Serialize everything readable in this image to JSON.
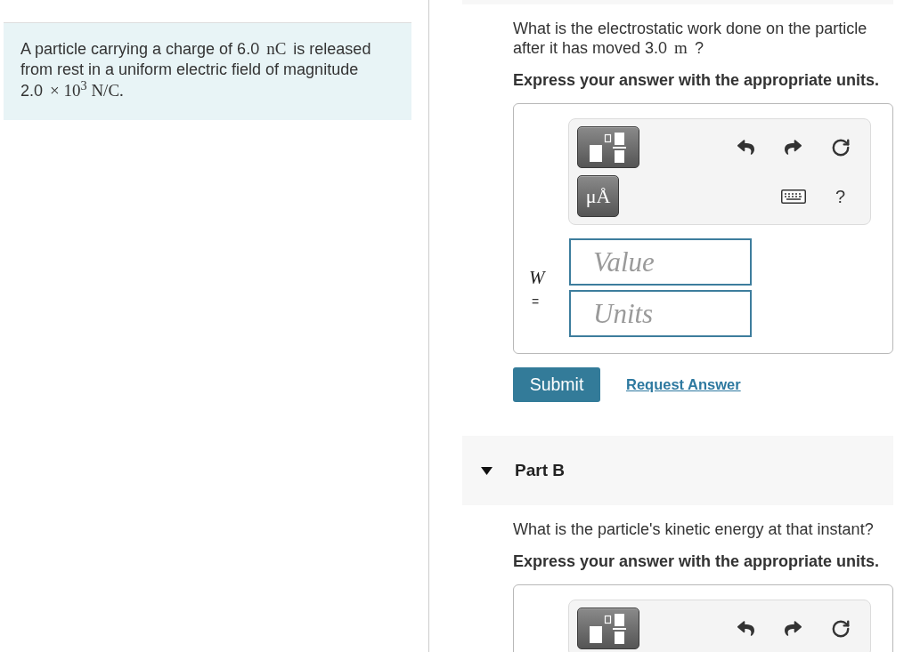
{
  "problem": {
    "segments": [
      {
        "kind": "text",
        "text": "A particle carrying a charge of 6.0 "
      },
      {
        "kind": "math",
        "text": "nC"
      },
      {
        "kind": "text",
        "text": " is released from rest in a uniform electric field of magnitude 2.0 "
      },
      {
        "kind": "math",
        "text": "× 10$^{3}$ N/C."
      }
    ]
  },
  "parts": [
    {
      "question": {
        "segments": [
          {
            "kind": "text",
            "text": "What is the electrostatic work done on the particle after it has moved 3.0 "
          },
          {
            "kind": "math",
            "text": "m"
          },
          {
            "kind": "text",
            "text": " ?"
          }
        ]
      },
      "instruction": "Express your answer with the appropriate units.",
      "answer": {
        "unit_button": "μÅ",
        "help": "?",
        "variable": "W",
        "equals": "=",
        "value_field": {
          "placeholder": "Value"
        },
        "units_field": {
          "placeholder": "Units"
        }
      },
      "actions": {
        "submit": "Submit",
        "request": "Request Answer"
      }
    },
    {
      "title": "Part B",
      "expanded": true,
      "question": {
        "segments": [
          {
            "kind": "text",
            "text": "What is the particle's kinetic energy at that instant?"
          }
        ]
      },
      "instruction": "Express your answer with the appropriate units."
    }
  ]
}
